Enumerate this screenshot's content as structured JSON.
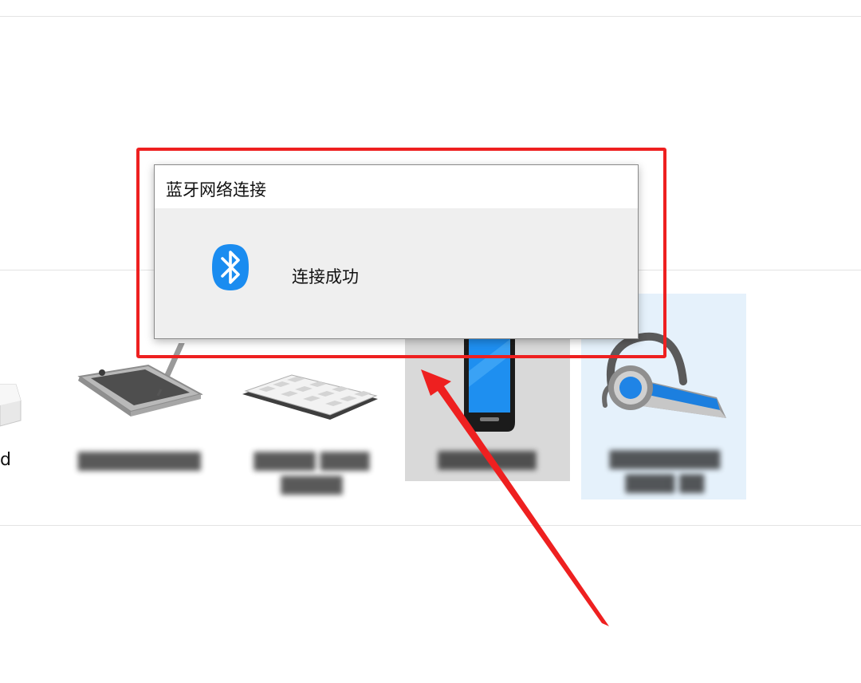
{
  "popup": {
    "title": "蓝牙网络连接",
    "message": "连接成功",
    "icon": "bluetooth-icon"
  },
  "devices": {
    "partial_label": "d",
    "items": [
      {
        "name": "drive-icon",
        "label": ""
      },
      {
        "name": "pen-tablet-icon",
        "label": "██████████"
      },
      {
        "name": "keyboard-icon",
        "label": "█████ ████",
        "label2": "█████"
      },
      {
        "name": "phone-icon",
        "label": "████████"
      },
      {
        "name": "headset-icon",
        "label": "█████████",
        "label2": "████ ██"
      }
    ]
  },
  "annotation": {
    "box_color": "#ee2020",
    "arrow_color": "#ee2020"
  },
  "colors": {
    "selected_gray": "#d9d9d9",
    "selected_blue": "#e5f1fb",
    "bluetooth_blue": "#1a8cf0"
  }
}
